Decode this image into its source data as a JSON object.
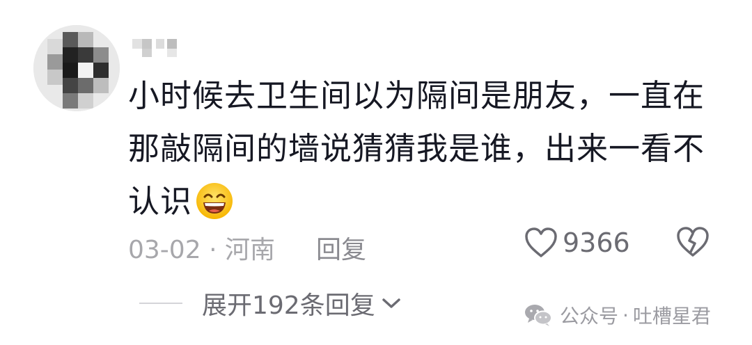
{
  "comment": {
    "text_lines": [
      "小时候去卫生间以为隔间是朋友，一直在",
      "那敲隔间的墙说猜猜我是谁，出来一看不",
      "认识"
    ],
    "emoji": "grinning-face-with-sweat-icon",
    "date": "03-02",
    "separator": "·",
    "location": "河南",
    "reply_label": "回复",
    "like_count": "9366"
  },
  "thread": {
    "expand_label": "展开192条回复"
  },
  "watermark": {
    "text": "公众号",
    "separator": "·",
    "account": "吐槽星君"
  },
  "colors": {
    "text": "#161823",
    "meta": "#a7a7ab",
    "icon_stroke": "#6b6b72"
  }
}
